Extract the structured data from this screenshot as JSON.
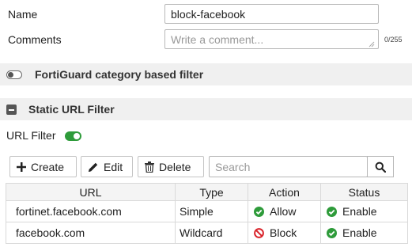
{
  "form": {
    "name_label": "Name",
    "name_value": "block-facebook",
    "comments_label": "Comments",
    "comments_placeholder": "Write a comment...",
    "comments_counter": "0/255"
  },
  "fortiguard": {
    "label": "FortiGuard category based filter",
    "enabled": false
  },
  "static_filter": {
    "label": "Static URL Filter",
    "url_filter_label": "URL Filter",
    "url_filter_enabled": true
  },
  "toolbar": {
    "create_label": "Create",
    "edit_label": "Edit",
    "delete_label": "Delete",
    "search_placeholder": "Search"
  },
  "table": {
    "headers": [
      "URL",
      "Type",
      "Action",
      "Status"
    ],
    "rows": [
      {
        "url": "fortinet.facebook.com",
        "type": "Simple",
        "action": "Allow",
        "action_icon": "check-circle-icon",
        "status": "Enable",
        "status_icon": "check-circle-icon"
      },
      {
        "url": "facebook.com",
        "type": "Wildcard",
        "action": "Block",
        "action_icon": "block-icon",
        "status": "Enable",
        "status_icon": "check-circle-icon"
      }
    ]
  },
  "colors": {
    "accent_green": "#2e9b3a",
    "block_red": "#d9242b",
    "toggle_off": "#666666"
  }
}
